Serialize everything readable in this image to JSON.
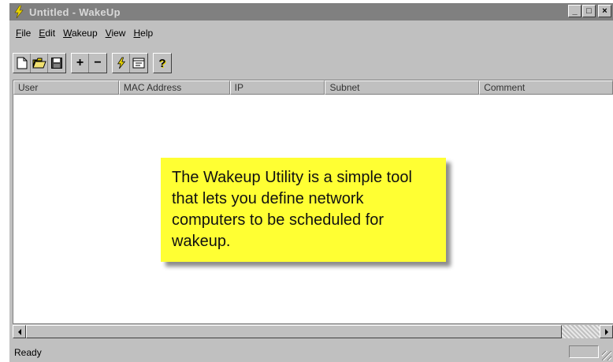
{
  "window": {
    "title": "Untitled - WakeUp",
    "controls": {
      "minimize": "_",
      "maximize": "□",
      "close": "×"
    }
  },
  "menu": [
    {
      "label": "File",
      "accel": "F",
      "rest": "ile"
    },
    {
      "label": "Edit",
      "accel": "E",
      "rest": "dit"
    },
    {
      "label": "Wakeup",
      "accel": "W",
      "rest": "akeup"
    },
    {
      "label": "View",
      "accel": "V",
      "rest": "iew"
    },
    {
      "label": "Help",
      "accel": "H",
      "rest": "elp"
    }
  ],
  "toolbar": {
    "new_icon": "new-document-icon",
    "open_icon": "open-folder-icon",
    "save_icon": "save-disk-icon",
    "add_label": "+",
    "remove_label": "−",
    "wakeup_icon": "lightning-icon",
    "schedule_icon": "calendar-icon",
    "help_label": "?"
  },
  "table": {
    "columns": [
      "User",
      "MAC Address",
      "IP",
      "Subnet",
      "Comment"
    ],
    "rows": []
  },
  "callout": {
    "text": "The Wakeup Utility is a simple tool that lets you define network computers to be scheduled for wakeup."
  },
  "status": {
    "text": "Ready"
  },
  "colors": {
    "callout_bg": "#ffff33",
    "window_bg": "#c0c0c0",
    "titlebar_inactive": "#808080"
  }
}
